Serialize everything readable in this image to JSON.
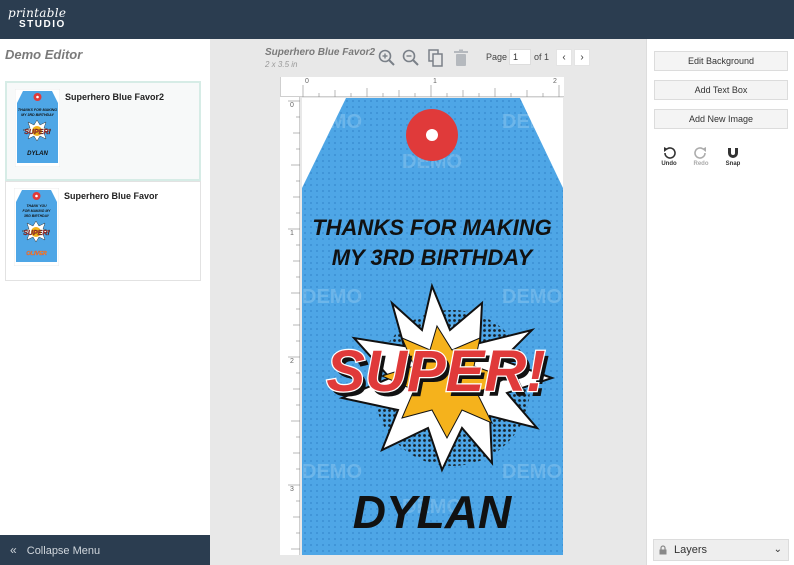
{
  "app": {
    "logo_line1": "printable",
    "logo_line2": "STUDIO"
  },
  "left_panel": {
    "title": "Demo Editor",
    "designs": [
      {
        "name": "Superhero Blue Favor2",
        "selected": true
      },
      {
        "name": "Superhero Blue Favor",
        "selected": false
      }
    ],
    "collapse_label": "Collapse Menu"
  },
  "toolbar": {
    "doc_name": "Superhero Blue Favor2",
    "doc_size": "2 x 3.5 in",
    "icons": [
      "zoom-in-icon",
      "zoom-out-icon",
      "copy-icon",
      "trash-icon"
    ],
    "page_label": "Page",
    "page_value": "1",
    "page_of": "of 1",
    "prev": "‹",
    "next": "›"
  },
  "rulers": {
    "top": [
      "0",
      "1",
      "2"
    ],
    "left": [
      "0",
      "1",
      "2",
      "3"
    ]
  },
  "tag": {
    "line1": "THANKS FOR MAKING",
    "line2": "MY 3RD BIRTHDAY",
    "burst_text": "SUPER!",
    "name": "DYLAN",
    "watermark": "DEMO",
    "colors": {
      "blue": "#4ea6e6",
      "red": "#e03a3a",
      "yellow": "#f5b21c",
      "ink": "#111111"
    }
  },
  "thumbs": [
    {
      "line1": "THANKS FOR MAKING",
      "line2": "MY 3RD BIRTHDAY",
      "burst": "SUPER!",
      "name": "DYLAN"
    },
    {
      "line1": "THANK YOU",
      "line2": "FOR MAKING MY",
      "line3": "3RD BIRTHDAY",
      "burst": "SUPER!",
      "name": "OLIVER"
    }
  ],
  "right_panel": {
    "edit_background": "Edit Background",
    "add_text_box": "Add Text Box",
    "add_new_image": "Add New Image",
    "undo": "Undo",
    "redo": "Redo",
    "snap": "Snap",
    "layers": "Layers"
  }
}
